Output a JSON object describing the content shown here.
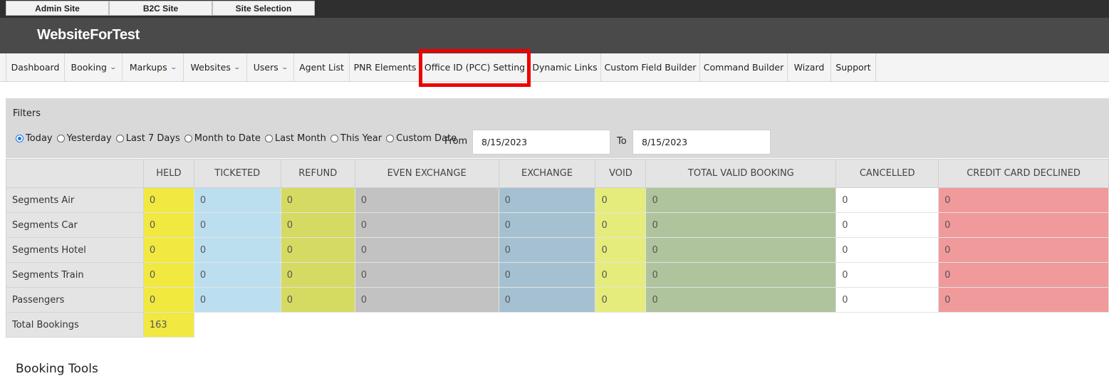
{
  "topbar": {
    "buttons": [
      "Admin Site",
      "B2C Site",
      "Site Selection"
    ]
  },
  "header": {
    "title": "WebsiteForTest"
  },
  "nav": {
    "items": [
      {
        "label": "Dashboard"
      },
      {
        "label": "Booking",
        "dropdown": true
      },
      {
        "label": "Markups",
        "dropdown": true
      },
      {
        "label": "Websites",
        "dropdown": true
      },
      {
        "label": "Users",
        "dropdown": true
      },
      {
        "label": "Agent List"
      },
      {
        "label": "PNR Elements"
      },
      {
        "label": "Office ID (PCC) Setting",
        "highlighted": true
      },
      {
        "label": "Dynamic Links"
      },
      {
        "label": "Custom Field Builder"
      },
      {
        "label": "Command Builder"
      },
      {
        "label": "Wizard"
      },
      {
        "label": "Support"
      }
    ],
    "highlight_color": "#ee0000"
  },
  "filters": {
    "title": "Filters",
    "radios": [
      {
        "label": "Today",
        "checked": true
      },
      {
        "label": "Yesterday",
        "checked": false
      },
      {
        "label": "Last 7 Days",
        "checked": false
      },
      {
        "label": "Month to Date",
        "checked": false
      },
      {
        "label": "Last Month",
        "checked": false
      },
      {
        "label": "This Year",
        "checked": false
      },
      {
        "label": "Custom Date",
        "checked": false
      }
    ],
    "from_label": "From",
    "from_value": "8/15/2023",
    "to_label": "To",
    "to_value": "8/15/2023"
  },
  "table": {
    "columns": [
      "HELD",
      "TICKETED",
      "REFUND",
      "EVEN EXCHANGE",
      "EXCHANGE",
      "VOID",
      "TOTAL VALID BOOKING",
      "CANCELLED",
      "CREDIT CARD DECLINED"
    ],
    "rows": [
      {
        "label": "Segments Air",
        "values": [
          "0",
          "0",
          "0",
          "0",
          "0",
          "0",
          "0",
          "0",
          "0"
        ]
      },
      {
        "label": "Segments Car",
        "values": [
          "0",
          "0",
          "0",
          "0",
          "0",
          "0",
          "0",
          "0",
          "0"
        ]
      },
      {
        "label": "Segments Hotel",
        "values": [
          "0",
          "0",
          "0",
          "0",
          "0",
          "0",
          "0",
          "0",
          "0"
        ]
      },
      {
        "label": "Segments Train",
        "values": [
          "0",
          "0",
          "0",
          "0",
          "0",
          "0",
          "0",
          "0",
          "0"
        ]
      },
      {
        "label": "Passengers",
        "values": [
          "0",
          "0",
          "0",
          "0",
          "0",
          "0",
          "0",
          "0",
          "0"
        ]
      }
    ],
    "total": {
      "label": "Total Bookings",
      "value": "163"
    },
    "colors": {
      "held": "#f1e840",
      "ticketed": "#bcdff0",
      "refund": "#d5da62",
      "even_exchange": "#c2c2c2",
      "exchange": "#a5c1d1",
      "void": "#e6ec7c",
      "total_valid": "#afc49d",
      "cancelled": "#ffffff",
      "declined": "#f09a9c"
    }
  },
  "booking_tools": {
    "title": "Booking Tools"
  }
}
